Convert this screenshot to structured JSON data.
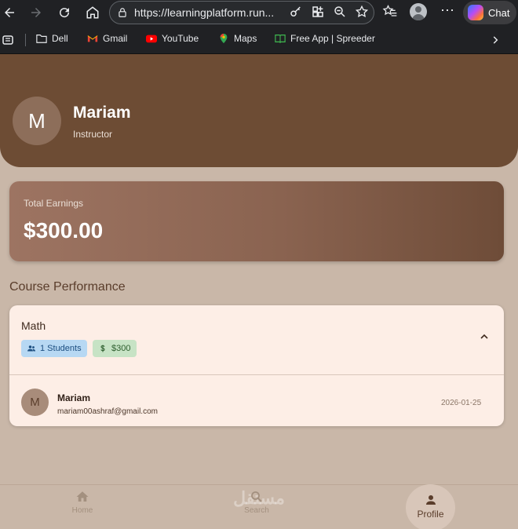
{
  "browser": {
    "url": "https://learningplatform.run...",
    "chat_label": "Chat",
    "more_label": "⋯",
    "bookmarks": [
      {
        "label": "Dell",
        "icon": "folder-icon"
      },
      {
        "label": "Gmail",
        "icon": "gmail-icon"
      },
      {
        "label": "YouTube",
        "icon": "youtube-icon"
      },
      {
        "label": "Maps",
        "icon": "maps-icon"
      },
      {
        "label": "Free App | Spreeder",
        "icon": "book-icon"
      }
    ]
  },
  "profile": {
    "initial": "M",
    "name": "Mariam",
    "role": "Instructor"
  },
  "earnings": {
    "label": "Total Earnings",
    "amount": "$300.00"
  },
  "section_title": "Course Performance",
  "course": {
    "title": "Math",
    "students_chip": "1 Students",
    "earnings_chip": "$300",
    "student": {
      "initial": "M",
      "name": "Mariam",
      "email": "mariam00ashraf@gmail.com",
      "date": "2026-01-25"
    }
  },
  "nav": {
    "home": "Home",
    "search": "Search",
    "profile": "Profile"
  },
  "watermark": "مستقل",
  "colors": {
    "header": "#6d4c34",
    "background": "#c9b7a8",
    "card": "#fdeee6",
    "students_chip": "#b7d8f3",
    "earnings_chip": "#c7e3c5"
  }
}
